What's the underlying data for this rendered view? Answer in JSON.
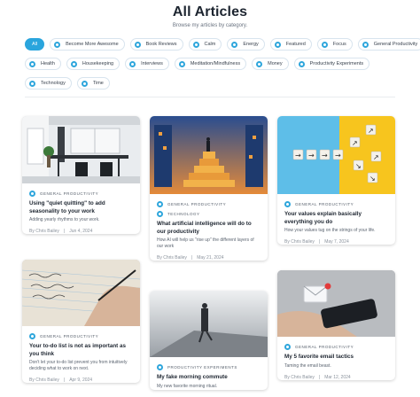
{
  "page": {
    "title": "All Articles",
    "subtitle": "Browse my articles by category."
  },
  "categories_row1": [
    "All",
    "Become More Awesome",
    "Book Reviews",
    "Calm",
    "Energy",
    "Featured",
    "Focus",
    "General Productivity"
  ],
  "categories_row2": [
    "Health",
    "Housekeeping",
    "Interviews",
    "Meditation/Mindfulness",
    "Money",
    "Productivity Experiments"
  ],
  "categories_row3": [
    "Technology",
    "Time"
  ],
  "active_category": "All",
  "articles": [
    {
      "category": "General Productivity",
      "title": "Using \"quiet quitting\" to add seasonality to your work",
      "desc": "Adding yearly rhythms to your work.",
      "author": "By Chris Bailey",
      "date": "Jun 4, 2024",
      "image": "office-interior-photo"
    },
    {
      "category": "General Productivity",
      "category2": "Technology",
      "title": "What artificial intelligence will do to our productivity",
      "desc": "How AI will help us \"rise up\" the different layers of our work",
      "author": "By Chris Bailey",
      "date": "May 21, 2024",
      "image": "ai-staircase-illustration"
    },
    {
      "category": "General Productivity",
      "title": "Your values explain basically everything you do",
      "desc": "How your values tug on the strings of your life.",
      "author": "By Chris Bailey",
      "date": "May 7, 2024",
      "image": "arrow-blocks-photo"
    },
    {
      "category": "General Productivity",
      "title": "Your to-do list is not as important as you think",
      "desc": "Don't let your to-do list prevent you from intuitively deciding what to work on next.",
      "author": "By Chris Bailey",
      "date": "Apr 9, 2024",
      "image": "handwriting-notebook-photo"
    },
    {
      "category": "Productivity Experiments",
      "title": "My fake morning commute",
      "desc": "My new favorite morning ritual.",
      "author": "",
      "date": "",
      "image": "walking-person-photo"
    },
    {
      "category": "General Productivity",
      "title": "My 5 favorite email tactics",
      "desc": "Taming the email beast.",
      "author": "By Chris Bailey",
      "date": "Mar 12, 2024",
      "image": "phone-email-photo"
    }
  ],
  "colors": {
    "accent": "#2aa5dd",
    "title": "#1d2530",
    "meta": "#8a929c"
  }
}
